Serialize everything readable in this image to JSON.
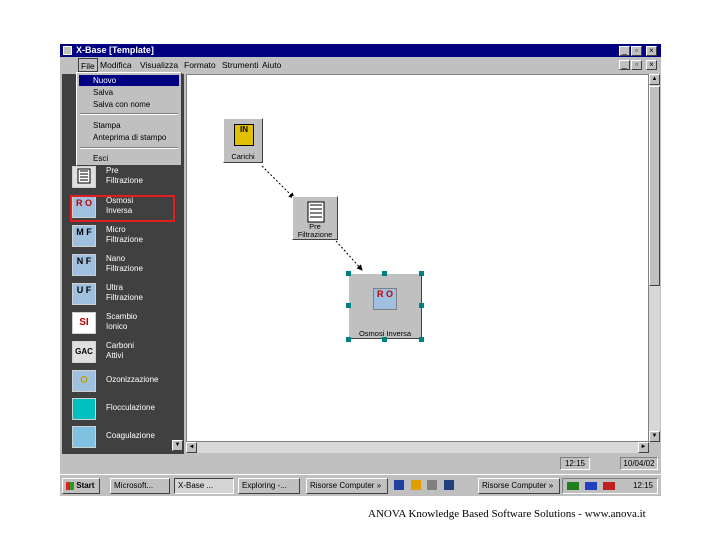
{
  "window": {
    "title": "X-Base   [Template]"
  },
  "menu": [
    "File",
    "Modifica",
    "Visualizza",
    "Formato",
    "Strumenti",
    "Aiuto"
  ],
  "file_menu": {
    "items": [
      "Nuovo",
      "Salva",
      "Salva con nome",
      "Stampa",
      "Anteprima di stampo",
      "Esci"
    ],
    "selected": "Nuovo"
  },
  "palette": [
    {
      "icon": "filter-icon",
      "label": "Pre\nFiltrazione"
    },
    {
      "icon": "ro-icon",
      "glyph": "R O",
      "label": "Osmosi\nInversa",
      "highlighted": true
    },
    {
      "icon": "mf-icon",
      "glyph": "M F",
      "label": "Micro\nFiltrazione"
    },
    {
      "icon": "nf-icon",
      "glyph": "N F",
      "label": "Nano\nFiltrazione"
    },
    {
      "icon": "uf-icon",
      "glyph": "U F",
      "label": "Ultra\nFiltrazione"
    },
    {
      "icon": "si-icon",
      "glyph": "SI",
      "label": "Scambio\nIonico"
    },
    {
      "icon": "gac-icon",
      "glyph": "GAC",
      "label": "Carboni\nAttivi"
    },
    {
      "icon": "ozone-icon",
      "glyph": "O",
      "label": "Ozonizzazione"
    },
    {
      "icon": "flocculation-icon",
      "label": "Flocculazione"
    },
    {
      "icon": "coagulation-icon",
      "label": "Coagulazione"
    }
  ],
  "diagram": {
    "nodes": [
      {
        "id": "carichi",
        "label": "Carichi",
        "glyph": "IN"
      },
      {
        "id": "prefiltrazione",
        "label": "Pre\nFiltrazione"
      },
      {
        "id": "osmosi",
        "label": "Osmosi Inversa",
        "glyph": "R O",
        "selected": true
      }
    ]
  },
  "status": {
    "time": "12:15",
    "date": "10/04/02"
  },
  "taskbar": {
    "start": "Start",
    "buttons": [
      "Microsoft...",
      "X-Base ...",
      "Exploring -...",
      "Risorse Computer »",
      "Risorse Computer »"
    ],
    "pressed": "X-Base ...",
    "clock": "12:15"
  },
  "footer": "ANOVA Knowledge Based Software Solutions -  www.anova.it",
  "colors": {
    "titlebar": "#000080",
    "palette_bg": "#404040",
    "highlight_box": "#e02020",
    "handle": "#008080"
  }
}
